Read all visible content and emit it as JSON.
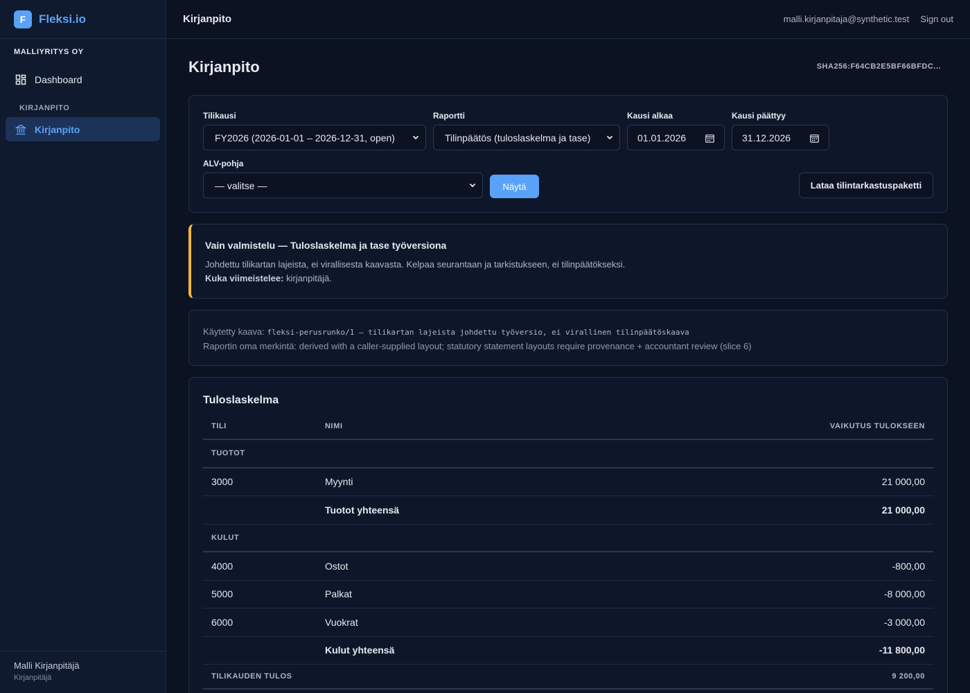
{
  "brand": {
    "logo_letter": "F",
    "name": "Fleksi.io"
  },
  "sidebar": {
    "org_name": "MALLIYRITYS OY",
    "dashboard_label": "Dashboard",
    "section_label": "KIRJANPITO",
    "kirjanpito_label": "Kirjanpito",
    "user_name": "Malli Kirjanpitäjä",
    "user_role": "Kirjanpitäjä"
  },
  "header": {
    "title": "Kirjanpito",
    "email": "malli.kirjanpitaja@synthetic.test",
    "sign_out": "Sign out"
  },
  "page": {
    "title": "Kirjanpito",
    "hash": "SHA256:F64CB2E5BF66BFDC..."
  },
  "filters": {
    "tilikausi_label": "Tilikausi",
    "tilikausi_value": "FY2026 (2026-01-01 – 2026-12-31, open)",
    "raportti_label": "Raportti",
    "raportti_value": "Tilinpäätös (tuloslaskelma ja tase)",
    "start_label": "Kausi alkaa",
    "start_value": "01.01.2026",
    "end_label": "Kausi päättyy",
    "end_value": "31.12.2026",
    "alv_label": "ALV-pohja",
    "alv_value": "— valitse —",
    "show_button": "Näytä",
    "download_button": "Lataa tilintarkastuspaketti"
  },
  "notice": {
    "title": "Vain valmistelu — Tuloslaskelma ja tase työversiona",
    "text": "Johdettu tilikartan lajeista, ei virallisesta kaavasta. Kelpaa seurantaan ja tarkistukseen, ei tilinpäätökseksi.",
    "finisher_label": "Kuka viimeistelee:",
    "finisher_value": "kirjanpitäjä."
  },
  "formula": {
    "label": "Käytetty kaava:",
    "code": "fleksi-perusrunko/1 — tilikartan lajeista johdettu työversio, ei virallinen tilinpäätöskaava",
    "note": "Raportin oma merkintä: derived with a caller-supplied layout; statutory statement layouts require provenance + accountant review (slice 6)"
  },
  "report": {
    "title": "Tuloslaskelma",
    "col_account": "TILI",
    "col_name": "NIMI",
    "col_effect": "VAIKUTUS TULOKSEEN",
    "income_section": "TUOTOT",
    "income_rows": [
      {
        "account": "3000",
        "name": "Myynti",
        "value": "21 000,00"
      }
    ],
    "income_total_label": "Tuotot yhteensä",
    "income_total_value": "21 000,00",
    "expense_section": "KULUT",
    "expense_rows": [
      {
        "account": "4000",
        "name": "Ostot",
        "value": "-800,00"
      },
      {
        "account": "5000",
        "name": "Palkat",
        "value": "-8 000,00"
      },
      {
        "account": "6000",
        "name": "Vuokrat",
        "value": "-3 000,00"
      }
    ],
    "expense_total_label": "Kulut yhteensä",
    "expense_total_value": "-11 800,00",
    "result_label": "TILIKAUDEN TULOS",
    "result_value": "9 200,00"
  }
}
